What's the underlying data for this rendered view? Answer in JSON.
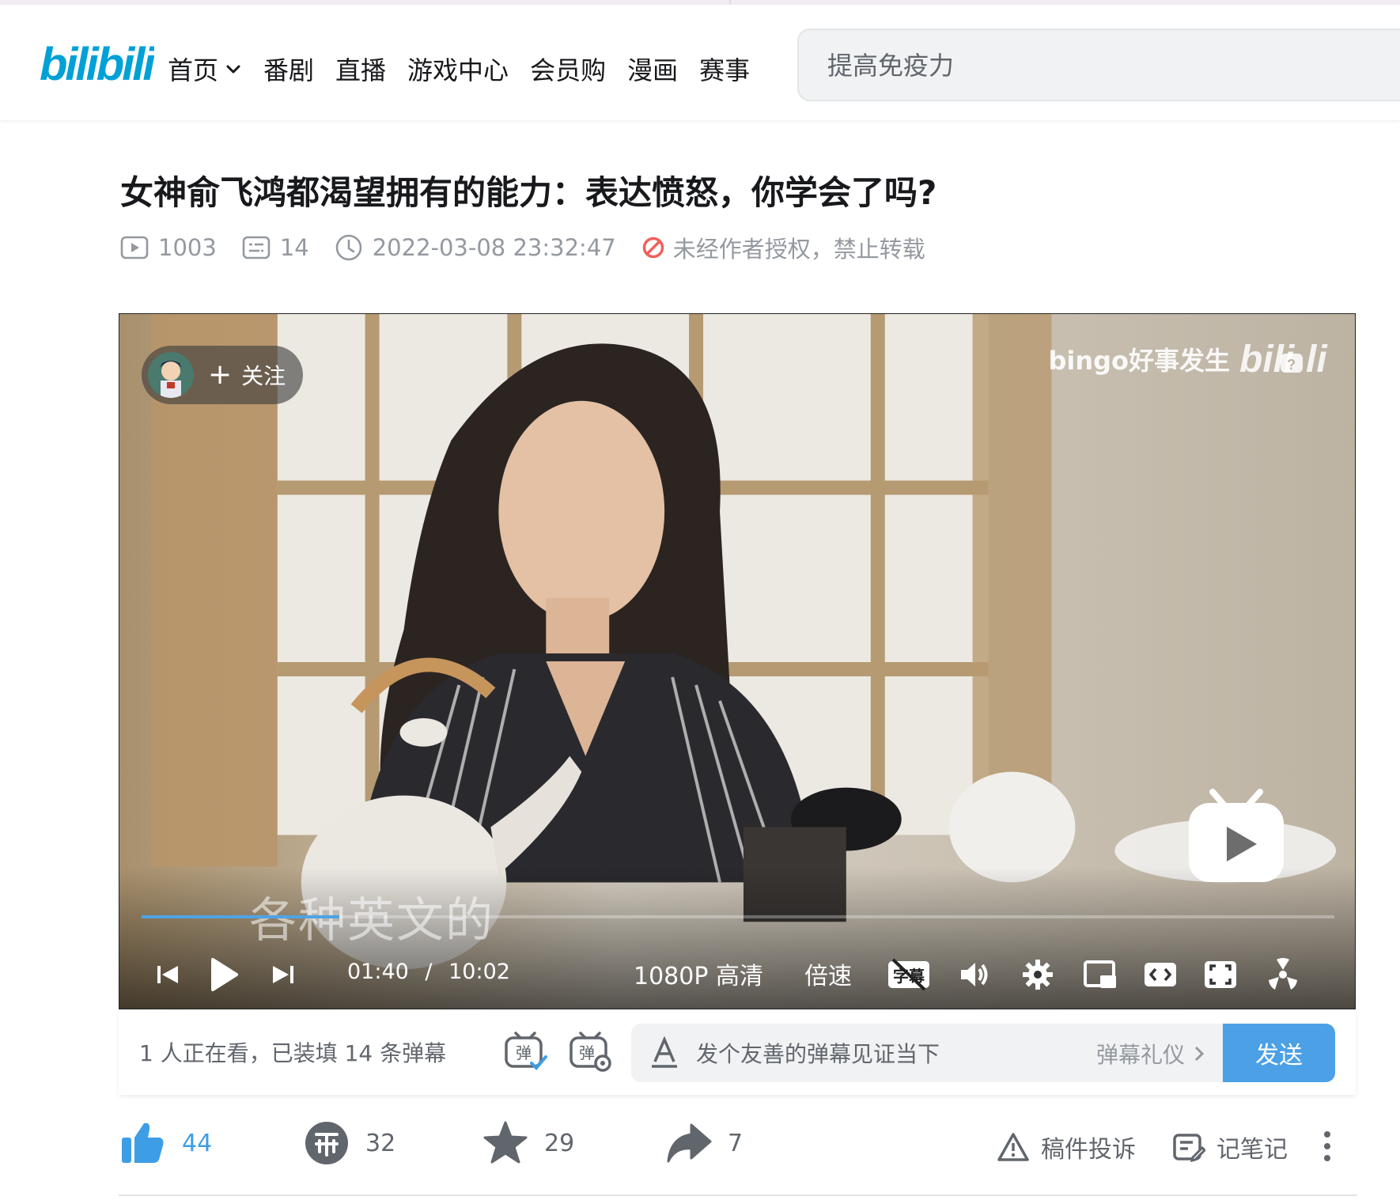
{
  "header": {
    "logo_text": "bilibili",
    "nav": [
      {
        "label": "首页",
        "has_dropdown": true
      },
      {
        "label": "番剧"
      },
      {
        "label": "直播"
      },
      {
        "label": "游戏中心"
      },
      {
        "label": "会员购"
      },
      {
        "label": "漫画"
      },
      {
        "label": "赛事"
      }
    ],
    "search_placeholder": "提高免疫力"
  },
  "video": {
    "title": "女神俞飞鸿都渴望拥有的能力：表达愤怒，你学会了吗?",
    "views": "1003",
    "danmaku_count": "14",
    "publish_time": "2022-03-08 23:32:47",
    "copyright_notice": "未经作者授权，禁止转载"
  },
  "player": {
    "follow_label": "关注",
    "watermark": "bingo好事发生",
    "subtitle_text": "各种英文的",
    "current_time": "01:40",
    "time_separator": "/",
    "duration": "10:02",
    "progress_fraction": 0.166,
    "quality": "1080P 高清",
    "speed": "倍速",
    "subtitle_btn_text": "字幕"
  },
  "danmaku": {
    "viewers_text": "1 人正在看，已装填 14 条弹幕",
    "toggle_on_glyph": "弹",
    "toggle_settings_glyph": "弹",
    "input_placeholder": "发个友善的弹幕见证当下",
    "etiquette": "弹幕礼仪",
    "send_label": "发送"
  },
  "toolbar": {
    "likes": "44",
    "coins": "32",
    "favorites": "29",
    "shares": "7",
    "report_label": "稿件投诉",
    "notes_label": "记笔记"
  },
  "colors": {
    "brand_blue": "#00a1d6",
    "accent_blue": "#4ba0e6",
    "text_gray": "#61666d",
    "meta_gray": "#9499a0",
    "warn_red": "#f25d59"
  }
}
